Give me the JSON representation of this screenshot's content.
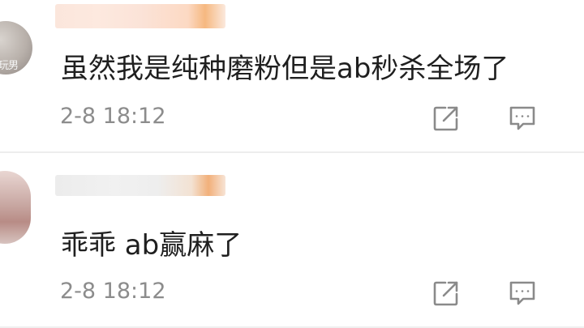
{
  "comments": [
    {
      "avatar_text": "玩男",
      "text": "虽然我是纯种磨粉但是ab秒杀全场了",
      "timestamp": "2-8 18:12",
      "share_icon": "share-icon",
      "comment_icon": "comment-icon"
    },
    {
      "text": "乖乖  ab赢麻了",
      "timestamp": "2-8 18:12",
      "share_icon": "share-icon",
      "comment_icon": "comment-icon"
    }
  ],
  "colors": {
    "text": "#1f1f1f",
    "meta": "#8c8c8c",
    "icon": "#8a8a8a",
    "divider": "#ededed"
  }
}
